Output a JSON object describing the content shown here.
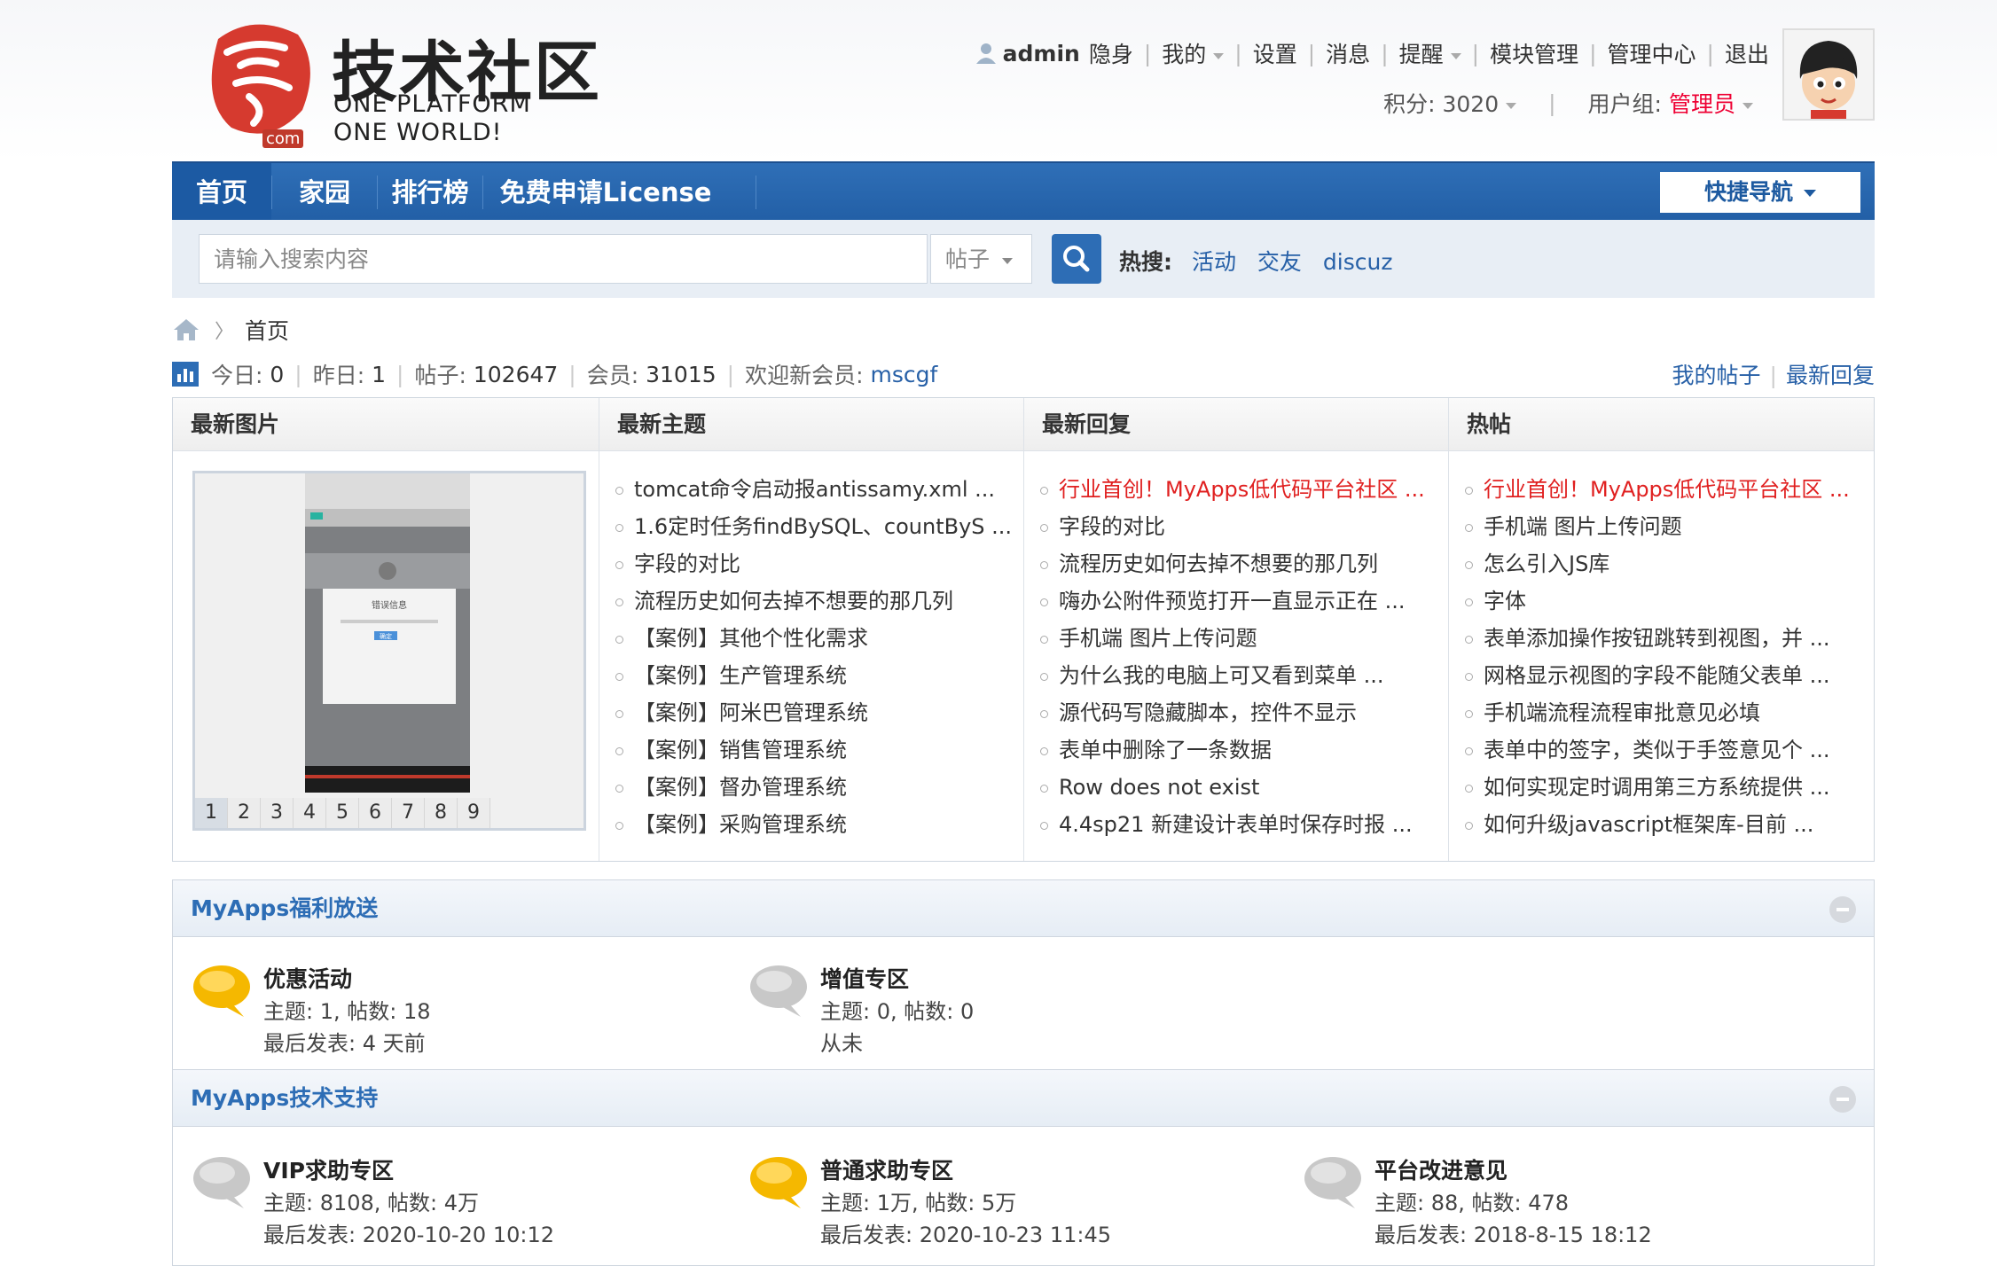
{
  "logo": {
    "title": "技术社区",
    "sub1": "ONE PLATFORM",
    "sub2": "ONE WORLD!",
    "com": "com"
  },
  "user_bar": {
    "username": "admin",
    "links": [
      "隐身",
      "我的",
      "设置",
      "消息",
      "提醒",
      "模块管理",
      "管理中心",
      "退出"
    ],
    "credits_label": "积分: 3020",
    "usergroup_label": "用户组:",
    "usergroup_value": "管理员"
  },
  "nav": {
    "items": [
      "首页",
      "家园",
      "排行榜",
      "免费申请License"
    ],
    "quicknav": "快捷导航"
  },
  "search": {
    "placeholder": "请输入搜索内容",
    "type": "帖子",
    "hot_label": "热搜:",
    "hot_links": [
      "活动",
      "交友",
      "discuz"
    ]
  },
  "breadcrumb": {
    "current": "首页"
  },
  "stats": {
    "today_label": "今日:",
    "today": "0",
    "yesterday_label": "昨日:",
    "yesterday": "1",
    "posts_label": "帖子:",
    "posts": "102647",
    "members_label": "会员:",
    "members": "31015",
    "newmember_label": "欢迎新会员:",
    "newmember": "mscgf",
    "my_posts": "我的帖子",
    "latest_replies": "最新回复"
  },
  "portal": {
    "heads": [
      "最新图片",
      "最新主题",
      "最新回复",
      "热帖"
    ],
    "pager": [
      "1",
      "2",
      "3",
      "4",
      "5",
      "6",
      "7",
      "8",
      "9"
    ],
    "slide_text": {
      "title": "错误信息",
      "ok": "确定"
    },
    "latest_topics": [
      "tomcat命令启动报antissamy.xml ...",
      "1.6定时任务findBySQL、countByS ...",
      "字段的对比",
      "流程历史如何去掉不想要的那几列",
      "【案例】其他个性化需求",
      "【案例】生产管理系统",
      "【案例】阿米巴管理系统",
      "【案例】销售管理系统",
      "【案例】督办管理系统",
      "【案例】采购管理系统"
    ],
    "latest_replies": [
      "行业首创！MyApps低代码平台社区 ...",
      "字段的对比",
      "流程历史如何去掉不想要的那几列",
      "嗨办公附件预览打开一直显示正在 ...",
      "手机端 图片上传问题",
      "为什么我的电脑上可又看到菜单 ...",
      "源代码写隐藏脚本，控件不显示",
      "表单中删除了一条数据",
      "Row does not exist",
      "4.4sp21 新建设计表单时保存时报 ..."
    ],
    "hot_posts": [
      "行业首创！MyApps低代码平台社区 ...",
      "手机端 图片上传问题",
      "怎么引入JS库",
      "字体",
      "表单添加操作按钮跳转到视图，并 ...",
      "网格显示视图的字段不能随父表单 ...",
      "手机端流程流程审批意见必填",
      "表单中的签字，类似于手签意见个 ...",
      "如何实现定时调用第三方系统提供 ...",
      "如何升级javascript框架库-目前 ..."
    ]
  },
  "sections": [
    {
      "title": "MyApps福利放送",
      "forums": [
        {
          "name": "优惠活动",
          "meta1": "主题: 1, 帖数: 18",
          "meta2": "最后发表: 4 天前",
          "icon": "new"
        },
        {
          "name": "增值专区",
          "meta1": "主题: 0, 帖数: 0",
          "meta2": "从未",
          "icon": "old"
        }
      ]
    },
    {
      "title": "MyApps技术支持",
      "forums": [
        {
          "name": "VIP求助专区",
          "meta1": "主题: 8108, 帖数: 4万",
          "meta2": "最后发表: 2020-10-20 10:12",
          "icon": "old"
        },
        {
          "name": "普通求助专区",
          "meta1": "主题: 1万, 帖数: 5万",
          "meta2": "最后发表: 2020-10-23 11:45",
          "icon": "new"
        },
        {
          "name": "平台改进意见",
          "meta1": "主题: 88, 帖数: 478",
          "meta2": "最后发表: 2018-8-15 18:12",
          "icon": "old"
        }
      ]
    }
  ],
  "colors": {
    "nav_blue": "#2f6fb7",
    "link_blue": "#2760a7",
    "red": "#e02020",
    "bubble_new": "#f5b800",
    "bubble_old": "#c8c8c8"
  }
}
